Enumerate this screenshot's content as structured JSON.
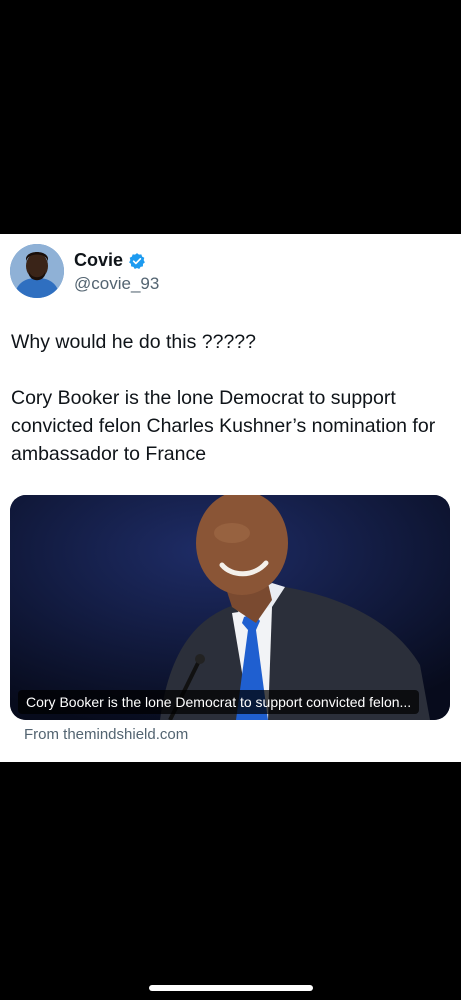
{
  "author": {
    "name": "Covie",
    "handle": "@covie_93",
    "avatar_icon": "profile-photo",
    "verified_icon": "verified-badge-icon",
    "verified_color": "#1d9bf0"
  },
  "tweet": {
    "line1": "Why would he do this ?????",
    "line2": "Cory Booker is the lone Democrat to support convicted felon Charles Kushner’s nomination for ambassador to France"
  },
  "link_card": {
    "caption": "Cory Booker is the lone Democrat to support convicted felon...",
    "source": "From themindshield.com"
  },
  "colors": {
    "primary_text": "#0f1419",
    "secondary_text": "#536471",
    "background": "#000000",
    "card": "#ffffff"
  }
}
